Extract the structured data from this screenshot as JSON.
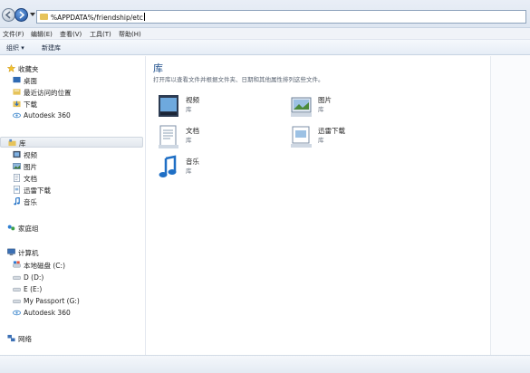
{
  "address": {
    "path": "%APPDATA%/friendship/etc"
  },
  "menu": [
    {
      "label": "文件(F)"
    },
    {
      "label": "编辑(E)"
    },
    {
      "label": "查看(V)"
    },
    {
      "label": "工具(T)"
    },
    {
      "label": "帮助(H)"
    }
  ],
  "toolbar": {
    "organize_label": "组织 ▾",
    "new_library_label": "新建库"
  },
  "sidebar": {
    "favorites": {
      "label": "收藏夹",
      "items": [
        {
          "label": "桌面"
        },
        {
          "label": "最近访问的位置"
        },
        {
          "label": "下载"
        },
        {
          "label": "Autodesk 360"
        }
      ]
    },
    "libraries": {
      "label": "库",
      "items": [
        {
          "label": "视频"
        },
        {
          "label": "图片"
        },
        {
          "label": "文档"
        },
        {
          "label": "迅雷下载"
        },
        {
          "label": "音乐"
        }
      ]
    },
    "homegroup": {
      "label": "家庭组"
    },
    "computer": {
      "label": "计算机",
      "items": [
        {
          "label": "本地磁盘 (C:)"
        },
        {
          "label": "D (D:)"
        },
        {
          "label": "E (E:)"
        },
        {
          "label": "My Passport (G:)"
        },
        {
          "label": "Autodesk 360"
        }
      ]
    },
    "network": {
      "label": "网络"
    }
  },
  "content": {
    "title": "库",
    "description": "打开库以查看文件并根据文件夹、日期和其他属性排列这些文件。",
    "libraries": [
      {
        "name": "视频",
        "sub": "库"
      },
      {
        "name": "图片",
        "sub": "库"
      },
      {
        "name": "文档",
        "sub": "库"
      },
      {
        "name": "迅雷下载",
        "sub": "库"
      },
      {
        "name": "音乐",
        "sub": "库"
      }
    ]
  },
  "colors": {
    "accent": "#1e4f8c",
    "selection": "#e2e7ee",
    "folder": "#e6c35a"
  }
}
